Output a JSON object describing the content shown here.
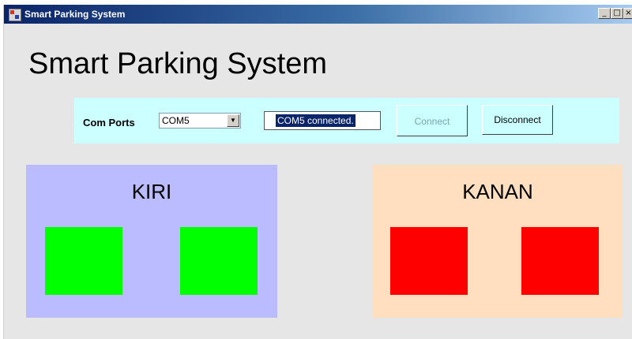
{
  "window": {
    "title": "Smart Parking System",
    "controls": {
      "minimize": "_",
      "maximize": "□",
      "close": "×"
    }
  },
  "header": {
    "title": "Smart Parking System"
  },
  "connection": {
    "com_ports_label": "Com Ports",
    "selected_port": "COM5",
    "status_text": "COM5 connected.",
    "connect_label": "Connect",
    "connect_enabled": false,
    "disconnect_label": "Disconnect"
  },
  "zones": [
    {
      "label": "KIRI",
      "background": "#bbbbff",
      "slots": [
        {
          "status_color": "#00ff00"
        },
        {
          "status_color": "#00ff00"
        }
      ]
    },
    {
      "label": "KANAN",
      "background": "#ffdfbf",
      "slots": [
        {
          "status_color": "#ff0000"
        },
        {
          "status_color": "#ff0000"
        }
      ]
    }
  ],
  "colors": {
    "connection_panel": "#ccffff",
    "window_bg": "#e6e6e6",
    "title_bar": "#0a246a"
  }
}
